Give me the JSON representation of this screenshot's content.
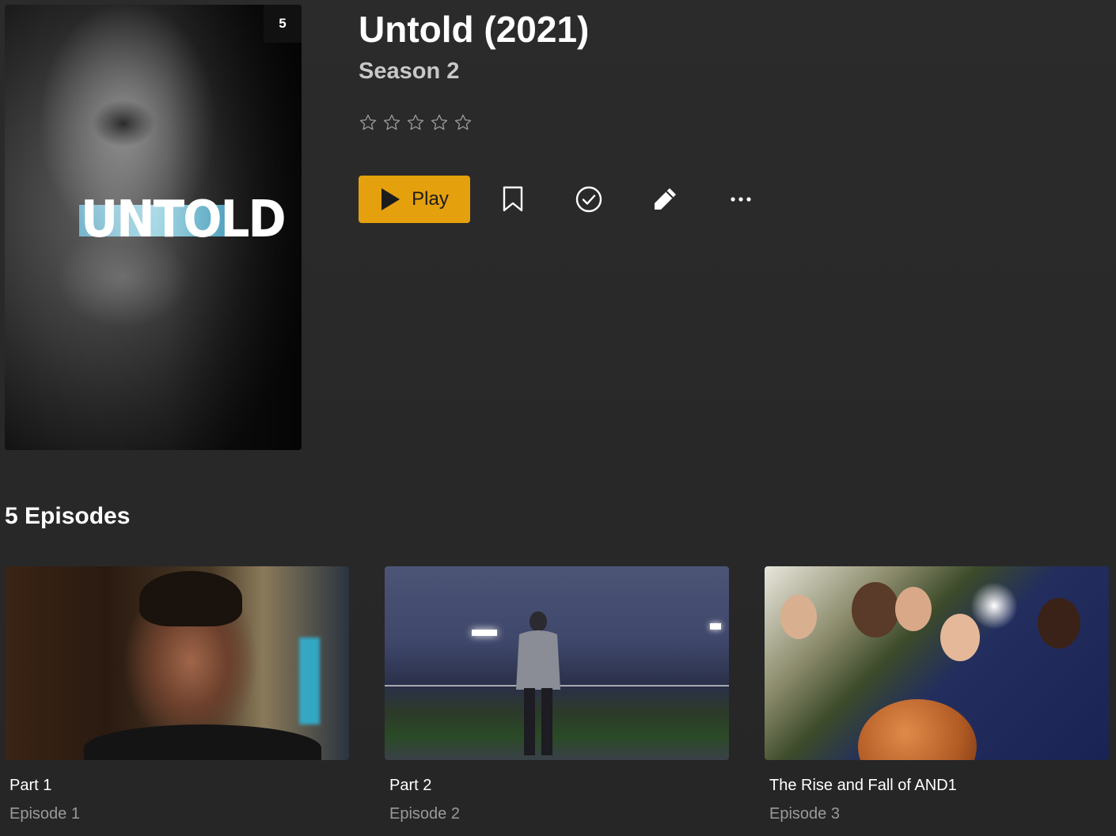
{
  "poster": {
    "logo_text": "UNTOLD",
    "badge": "5"
  },
  "show": {
    "title": "Untold (2021)",
    "season": "Season 2",
    "rating_stars": 5,
    "rating_value": 0
  },
  "actions": {
    "play_label": "Play",
    "accent_color": "#e5a00d",
    "icons": [
      "bookmark-icon",
      "check-circle-icon",
      "pencil-icon",
      "more-icon"
    ]
  },
  "episodes": {
    "heading": "5 Episodes",
    "items": [
      {
        "title": "Part 1",
        "number": "Episode 1"
      },
      {
        "title": "Part 2",
        "number": "Episode 2"
      },
      {
        "title": "The Rise and Fall of AND1",
        "number": "Episode 3"
      }
    ]
  }
}
